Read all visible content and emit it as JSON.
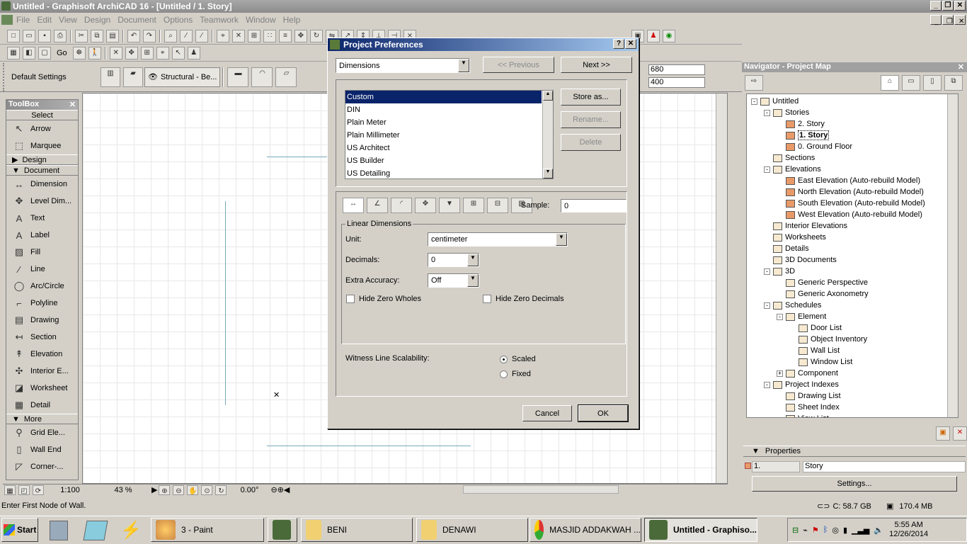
{
  "window": {
    "title": "Untitled - Graphisoft ArchiCAD 16 - [Untitled / 1. Story]"
  },
  "menu": [
    "File",
    "Edit",
    "View",
    "Design",
    "Document",
    "Options",
    "Teamwork",
    "Window",
    "Help"
  ],
  "toolbar2": {
    "go_label": "Go"
  },
  "infobox": {
    "default_settings": "Default Settings",
    "structural": "Structural - Be...",
    "field_a": "680",
    "field_b": "400"
  },
  "toolbox": {
    "title": "ToolBox",
    "select": "Select",
    "tools_select": [
      {
        "icon": "arrow-icon",
        "label": "Arrow"
      },
      {
        "icon": "marquee-icon",
        "label": "Marquee"
      }
    ],
    "group_design": "Design",
    "group_document": "Document",
    "tools_document": [
      {
        "icon": "dimension-icon",
        "label": "Dimension"
      },
      {
        "icon": "level-dimension-icon",
        "label": "Level Dim..."
      },
      {
        "icon": "text-icon",
        "label": "Text"
      },
      {
        "icon": "label-icon",
        "label": "Label"
      },
      {
        "icon": "fill-icon",
        "label": "Fill"
      },
      {
        "icon": "line-icon",
        "label": "Line"
      },
      {
        "icon": "arc-circle-icon",
        "label": "Arc/Circle"
      },
      {
        "icon": "polyline-icon",
        "label": "Polyline"
      },
      {
        "icon": "drawing-icon",
        "label": "Drawing"
      },
      {
        "icon": "section-icon",
        "label": "Section"
      },
      {
        "icon": "elevation-icon",
        "label": "Elevation"
      },
      {
        "icon": "interior-elevation-icon",
        "label": "Interior E..."
      },
      {
        "icon": "worksheet-icon",
        "label": "Worksheet"
      },
      {
        "icon": "detail-icon",
        "label": "Detail"
      }
    ],
    "group_more": "More",
    "tools_more": [
      {
        "icon": "grid-element-icon",
        "label": "Grid Ele..."
      },
      {
        "icon": "wall-end-icon",
        "label": "Wall End"
      },
      {
        "icon": "corner-icon",
        "label": "Corner-..."
      }
    ]
  },
  "dialog": {
    "title": "Project Preferences",
    "category": "Dimensions",
    "prev_label": "<< Previous",
    "next_label": "Next >>",
    "standards": [
      "Custom",
      "DIN",
      "Plain Meter",
      "Plain Millimeter",
      "US Architect",
      "US Builder",
      "US Detailing"
    ],
    "selected_index": 0,
    "store_as": "Store as...",
    "rename": "Rename...",
    "delete": "Delete",
    "sample_label": "Sample:",
    "sample_value": "0",
    "group_title": "Linear Dimensions",
    "unit_label": "Unit:",
    "unit_value": "centimeter",
    "decimals_label": "Decimals:",
    "decimals_value": "0",
    "extra_label": "Extra Accuracy:",
    "extra_value": "Off",
    "hide_zero_wholes": "Hide Zero Wholes",
    "hide_zero_decimals": "Hide Zero Decimals",
    "witness_label": "Witness Line Scalability:",
    "scaled": "Scaled",
    "fixed": "Fixed",
    "cancel": "Cancel",
    "ok": "OK"
  },
  "navigator": {
    "title": "Navigator - Project Map",
    "properties": "Properties",
    "prop_id": "1.",
    "prop_name": "Story",
    "settings": "Settings...",
    "tree": [
      {
        "label": "Untitled",
        "level": 0,
        "exp": "-"
      },
      {
        "label": "Stories",
        "level": 1,
        "exp": "-"
      },
      {
        "label": "2. Story",
        "level": 2
      },
      {
        "label": "1. Story",
        "level": 2,
        "selected": true
      },
      {
        "label": "0. Ground Floor",
        "level": 2
      },
      {
        "label": "Sections",
        "level": 1
      },
      {
        "label": "Elevations",
        "level": 1,
        "exp": "-"
      },
      {
        "label": "East Elevation (Auto-rebuild Model)",
        "level": 2
      },
      {
        "label": "North Elevation (Auto-rebuild Model)",
        "level": 2
      },
      {
        "label": "South Elevation (Auto-rebuild Model)",
        "level": 2
      },
      {
        "label": "West Elevation (Auto-rebuild Model)",
        "level": 2
      },
      {
        "label": "Interior Elevations",
        "level": 1
      },
      {
        "label": "Worksheets",
        "level": 1
      },
      {
        "label": "Details",
        "level": 1
      },
      {
        "label": "3D Documents",
        "level": 1
      },
      {
        "label": "3D",
        "level": 1,
        "exp": "-"
      },
      {
        "label": "Generic Perspective",
        "level": 2
      },
      {
        "label": "Generic Axonometry",
        "level": 2
      },
      {
        "label": "Schedules",
        "level": 1,
        "exp": "-"
      },
      {
        "label": "Element",
        "level": 2,
        "exp": "-"
      },
      {
        "label": "Door List",
        "level": 3
      },
      {
        "label": "Object Inventory",
        "level": 3
      },
      {
        "label": "Wall List",
        "level": 3
      },
      {
        "label": "Window List",
        "level": 3
      },
      {
        "label": "Component",
        "level": 2,
        "exp": "+"
      },
      {
        "label": "Project Indexes",
        "level": 1,
        "exp": "-"
      },
      {
        "label": "Drawing List",
        "level": 2
      },
      {
        "label": "Sheet Index",
        "level": 2
      },
      {
        "label": "View List",
        "level": 2
      }
    ]
  },
  "statusbar": {
    "scale": "1:100",
    "zoom": "43 %",
    "angle": "0.00°",
    "hint": "Enter First Node of Wall.",
    "disk": "C: 58.7 GB",
    "mem": "170.4 MB"
  },
  "taskbar": {
    "start": "Start",
    "tasks": [
      "3 - Paint",
      "BENI",
      "DENAWI",
      "MASJID ADDAKWAH ...",
      "Untitled - Graphiso..."
    ],
    "time": "5:55 AM",
    "date": "12/26/2014"
  }
}
